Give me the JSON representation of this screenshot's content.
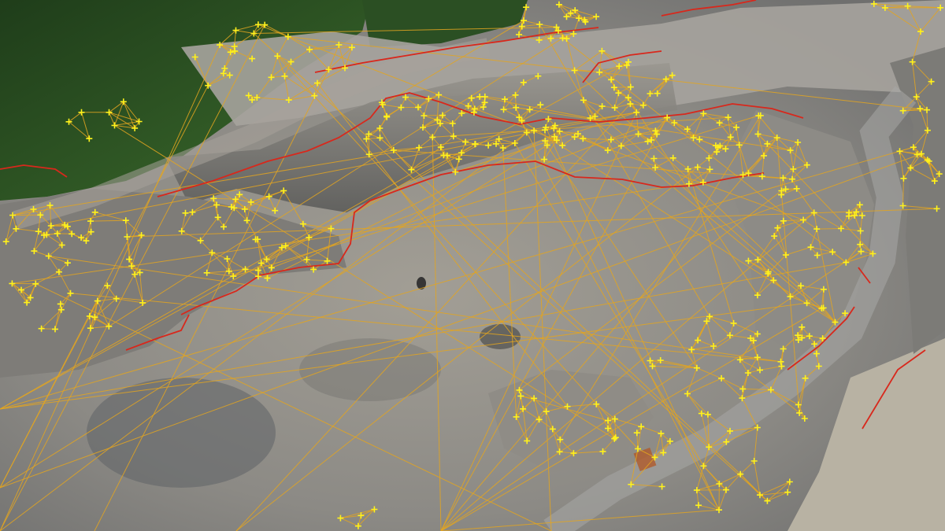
{
  "colors": {
    "quarry_floor": "#8a8a86",
    "quarry_floor_light": "#a8a39a",
    "rock_face": "#6e6e6c",
    "vegetation": "#2f5a25",
    "vegetation_dark": "#1f3d1a",
    "mesh_edges": "#e3a520",
    "breaklines": "#d8281c",
    "survey_points": "#fff21c"
  },
  "icons": {
    "survey_point": "plus-marker-icon"
  }
}
